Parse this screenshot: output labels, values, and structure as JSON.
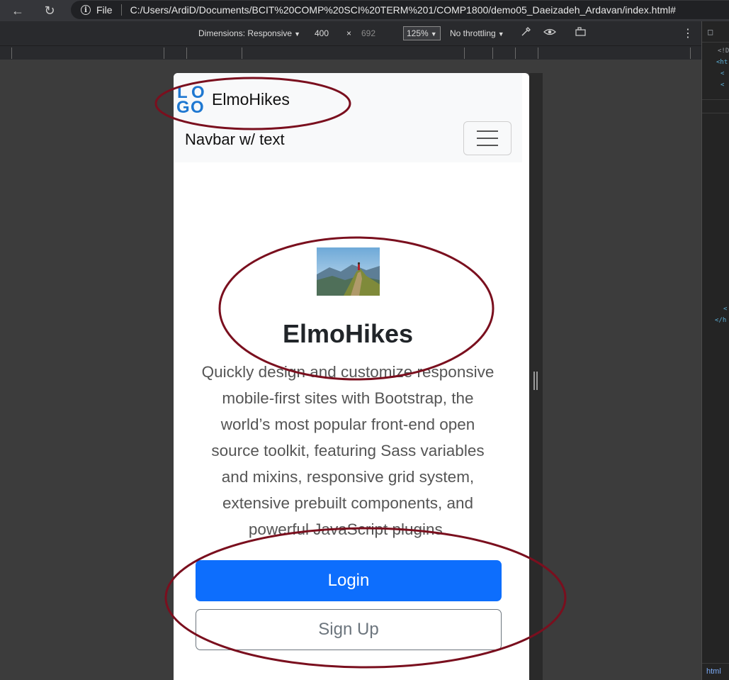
{
  "browser": {
    "url_scheme": "File",
    "url": "C:/Users/ArdiD/Documents/BCIT%20COMP%20SCI%20TERM%201/COMP1800/demo05_Daeizadeh_Ardavan/index.html#"
  },
  "device_toolbar": {
    "dimensions": "Dimensions: Responsive",
    "width": "400",
    "times": "×",
    "height": "692",
    "zoom": "125%",
    "throttling": "No throttling"
  },
  "devtools": {
    "lines": [
      "<!D",
      "<ht",
      "<",
      "<",
      "<",
      "</h"
    ],
    "tab": "html"
  },
  "page": {
    "logo_letters": [
      "L",
      "O",
      "G",
      "O"
    ],
    "brand": "ElmoHikes",
    "navbar_text": "Navbar w/ text",
    "hero_title": "ElmoHikes",
    "lead": "Quickly design and customize responsive mobile-first sites with Bootstrap, the world’s most popular front-end open source toolkit, featuring Sass variables and mixins, responsive grid system, extensive prebuilt components, and powerful JavaScript plugins.",
    "login_label": "Login",
    "signup_label": "Sign Up"
  },
  "colors": {
    "primary": "#0d6efd",
    "annotation": "#7a0f1e",
    "logo_blue": "#1f78d1"
  }
}
